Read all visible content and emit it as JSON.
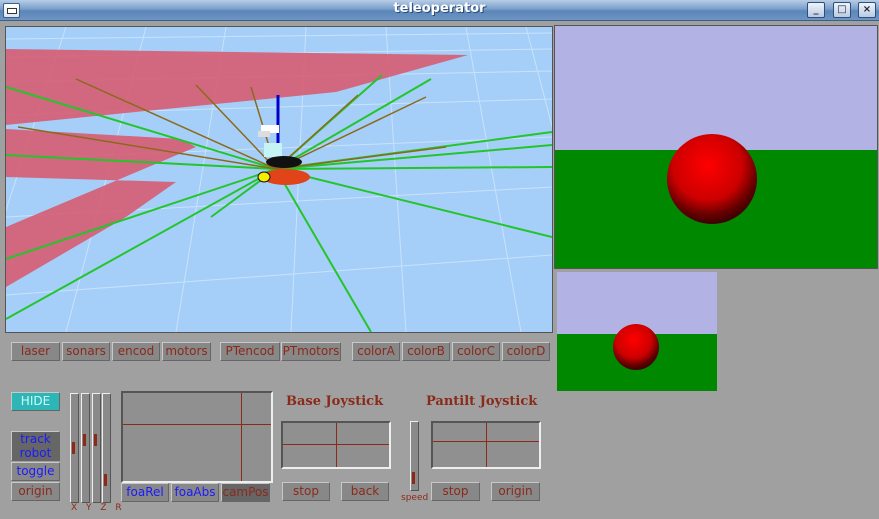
{
  "window": {
    "title": "teleoperator",
    "controls": [
      "_",
      "□",
      "×"
    ]
  },
  "toggles": [
    "laser",
    "sonars",
    "encod",
    "motors",
    "PTencod",
    "PTmotors",
    "colorA",
    "colorB",
    "colorC",
    "colorD"
  ],
  "left_controls": {
    "hide": "HIDE",
    "track_robot": "track robot",
    "toggle": "toggle",
    "origin": "origin"
  },
  "sliders": {
    "labels": "X Y Z R"
  },
  "foa": {
    "rel": "foaRel",
    "abs": "foaAbs",
    "cam": "camPos"
  },
  "base_joystick": {
    "title": "Base Joystick",
    "stop": "stop",
    "back": "back"
  },
  "speed": {
    "label": "speed"
  },
  "pantilt_joystick": {
    "title": "Pantilt Joystick",
    "stop": "stop",
    "origin": "origin"
  },
  "colors": {
    "sky": "#a5cff8",
    "floor_patch": "#d65f74",
    "laser": "#23c52a",
    "camera_sky": "#b2b2e4",
    "camera_ground": "#008800",
    "ball": "#ff0000"
  }
}
